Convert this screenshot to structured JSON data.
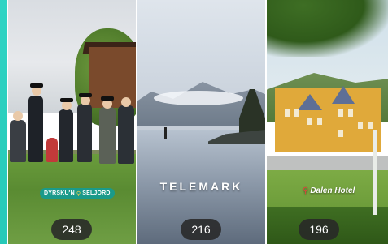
{
  "colors": {
    "accent": "#2fd4c4",
    "badge": "#1a9a8a",
    "pill": "#282828"
  },
  "cards": [
    {
      "location_badge": {
        "left": "DYRSKU'N",
        "right": "SELJORD",
        "icon": "pin-icon"
      },
      "count": "248"
    },
    {
      "overlay_title": "TELEMARK",
      "count": "216"
    },
    {
      "location_label": "Dalen Hotel",
      "location_icon": "pin-icon",
      "count": "196"
    }
  ]
}
